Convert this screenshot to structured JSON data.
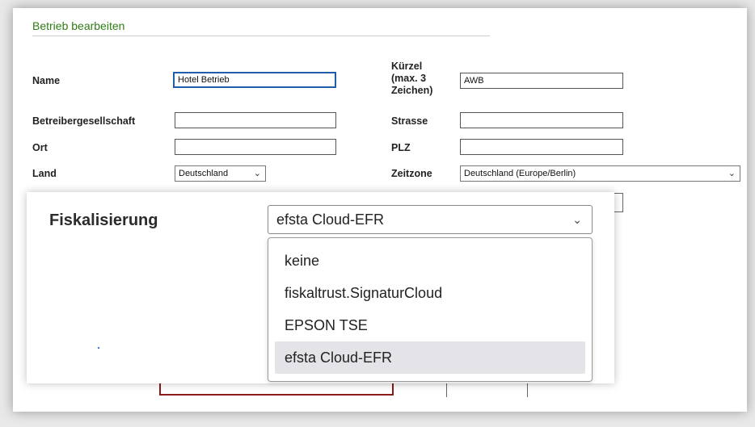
{
  "form": {
    "section_title": "Betrieb bearbeiten",
    "fields": {
      "name": {
        "label": "Name",
        "value": "Hotel Betrieb"
      },
      "kuerzel": {
        "label_1": "Kürzel",
        "label_2": "(max. 3",
        "label_3": "Zeichen)",
        "value": "AWB"
      },
      "betreibergesellschaft": {
        "label": "Betreibergesellschaft",
        "value": ""
      },
      "strasse": {
        "label": "Strasse",
        "value": ""
      },
      "ort": {
        "label": "Ort",
        "value": ""
      },
      "plz": {
        "label": "PLZ",
        "value": ""
      },
      "land": {
        "label": "Land",
        "value": "Deutschland"
      },
      "zeitzone": {
        "label": "Zeitzone",
        "value": "Deutschland (Europe/Berlin)"
      }
    }
  },
  "fiskalisierung": {
    "label": "Fiskalisierung",
    "selected": "efsta Cloud-EFR",
    "options": [
      "keine",
      "fiskaltrust.SignaturCloud",
      "EPSON TSE",
      "efsta Cloud-EFR"
    ]
  },
  "icons": {
    "dropdown": "chevron-down-icon"
  },
  "colors": {
    "title_green": "#2f7d16",
    "focus_blue": "#1f5ea8",
    "highlight": "#e3e3e8"
  }
}
